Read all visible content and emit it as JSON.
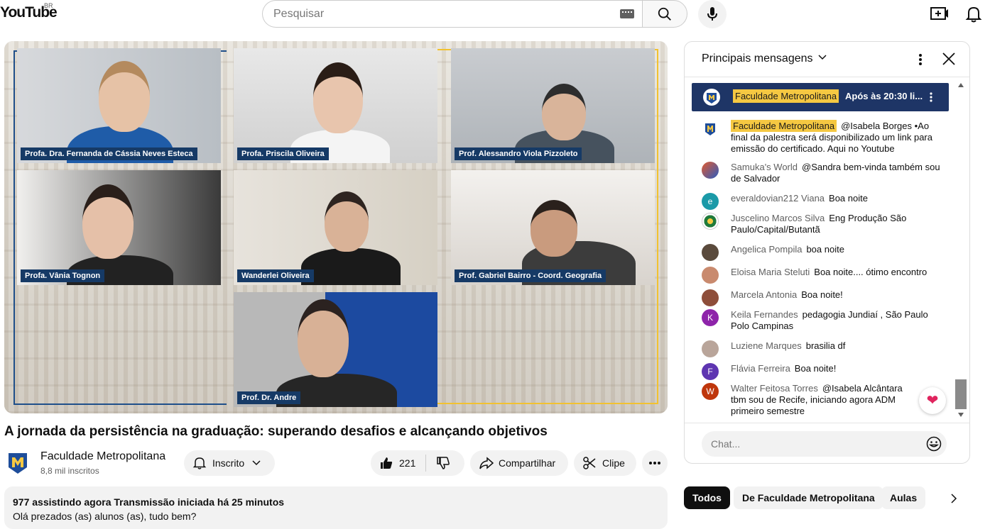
{
  "header": {
    "logo_text": "YouTube",
    "country_code": "BR",
    "search_placeholder": "Pesquisar"
  },
  "video": {
    "participants": [
      {
        "name": "Profa. Dra. Fernanda de Cássia Neves Esteca"
      },
      {
        "name": "Profa. Priscila Oliveira"
      },
      {
        "name": "Prof. Alessandro Viola Pizzoleto"
      },
      {
        "name": "Profa. Vânia Tognon"
      },
      {
        "name": "Wanderlei Oliveira"
      },
      {
        "name": "Prof. Gabriel Bairro - Coord. Geografia"
      },
      {
        "name": "Prof. Dr. Andre"
      }
    ],
    "title": "A jornada da persistência na graduação: superando desafios e alcançando objetivos"
  },
  "channel": {
    "name": "Faculdade Metropolitana",
    "subscribers": "8,8 mil inscritos",
    "subscribed_label": "Inscrito",
    "likes": "221",
    "share_label": "Compartilhar",
    "clip_label": "Clipe"
  },
  "description": {
    "meta": "977 assistindo agora  Transmissão iniciada há 25 minutos",
    "text": "Olá prezados (as) alunos (as), tudo bem?"
  },
  "chat": {
    "title": "Principais mensagens",
    "pinned_author": "Faculdade Metropolitana",
    "pinned_text": "Após às 20:30 li...",
    "messages": [
      {
        "author": "Faculdade Metropolitana",
        "text": "@Isabela Borges •Ao final da palestra será disponibilizado um link para emissão do certificado. Aqui no Youtube"
      },
      {
        "author": "Samuka's World",
        "text": "@Sandra bem-vinda também sou de Salvador"
      },
      {
        "author": "everaldovian212 Viana",
        "text": "Boa noite",
        "initial": "e"
      },
      {
        "author": "Juscelino Marcos Silva",
        "text": "Eng Produção São Paulo/Capital/Butantã"
      },
      {
        "author": "Angelica Pompila",
        "text": "boa noite"
      },
      {
        "author": "Eloisa Maria Steluti",
        "text": "Boa noite.... ótimo encontro"
      },
      {
        "author": "Marcela Antonia",
        "text": "Boa noite!"
      },
      {
        "author": "Keila Fernandes",
        "text": "pedagogia Jundiaí , São Paulo Polo Campinas",
        "initial": "K"
      },
      {
        "author": "Luziene Marques",
        "text": "brasilia df"
      },
      {
        "author": "Flávia Ferreira",
        "text": "Boa noite!",
        "initial": "F"
      },
      {
        "author": "Walter Feitosa Torres",
        "text": "@Isabela Alcântara tbm sou de Recife, iniciando agora ADM primeiro semestre",
        "initial": "W"
      }
    ],
    "input_placeholder": "Chat..."
  },
  "chips": {
    "all": "Todos",
    "from_channel": "De Faculdade Metropolitana",
    "lessons": "Aulas"
  },
  "colors": {
    "accent_blue": "#1e3566",
    "highlight_yellow": "#f5c842",
    "name_tag": "#163a66"
  }
}
